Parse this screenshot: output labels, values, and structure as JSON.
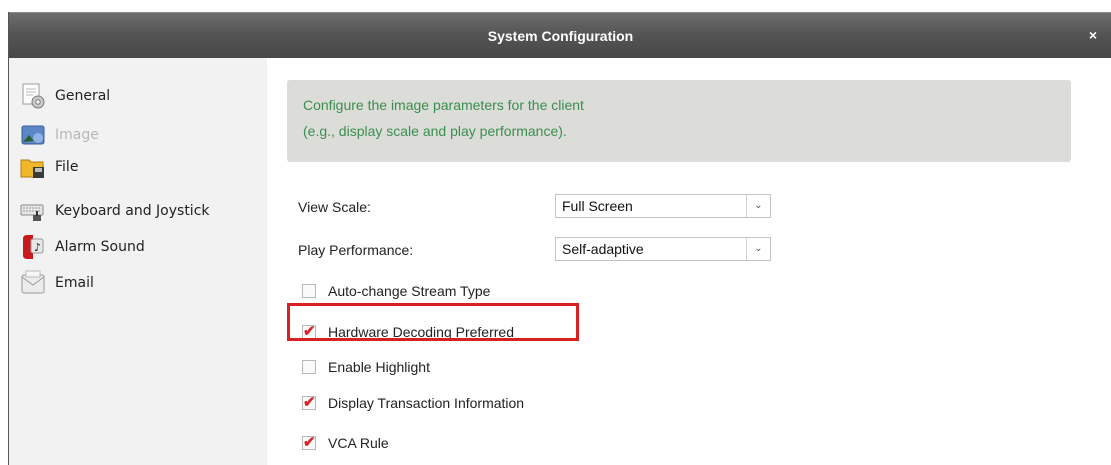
{
  "window": {
    "title": "System Configuration",
    "close_glyph": "×"
  },
  "sidebar": {
    "items": [
      {
        "label": "General",
        "icon": "general-settings-icon",
        "state": "normal"
      },
      {
        "label": "Image",
        "icon": "image-icon",
        "state": "disabled"
      },
      {
        "label": "File",
        "icon": "folder-icon",
        "state": "normal"
      },
      {
        "label": "Keyboard and Joystick",
        "icon": "keyboard-icon",
        "state": "normal"
      },
      {
        "label": "Alarm Sound",
        "icon": "alarm-speaker-icon",
        "state": "normal"
      },
      {
        "label": "Email",
        "icon": "email-icon",
        "state": "normal"
      }
    ]
  },
  "main": {
    "info_lines": [
      "Configure the image parameters for the client",
      "(e.g., display scale and play performance)."
    ],
    "view_scale": {
      "label": "View Scale:",
      "value": "Full Screen"
    },
    "play_performance": {
      "label": "Play Performance:",
      "value": "Self-adaptive"
    },
    "dropdown_arrow_glyph": "⌄",
    "options": [
      {
        "label": "Auto-change Stream Type",
        "checked": false
      },
      {
        "label": "Hardware Decoding Preferred",
        "checked": true,
        "highlighted": true
      },
      {
        "label": "Enable Highlight",
        "checked": false
      },
      {
        "label": "Display Transaction Information",
        "checked": true
      },
      {
        "label": "VCA Rule",
        "checked": true
      }
    ]
  },
  "colors": {
    "accent_check": "#d6262d",
    "info_text": "#3a8f4f",
    "highlight_border": "#d7201f",
    "titlebar": "#555555"
  }
}
